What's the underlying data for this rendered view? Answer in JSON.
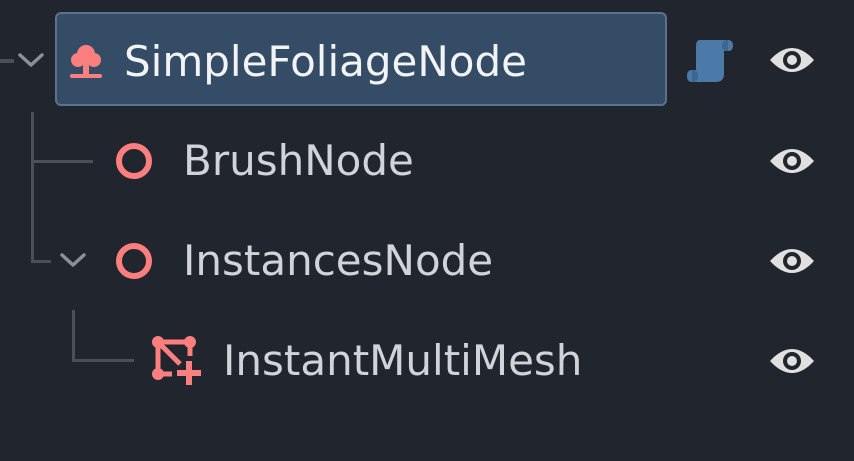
{
  "tree": {
    "nodes": [
      {
        "label": "SimpleFoliageNode",
        "icon": "foliage-tree-icon",
        "selected": true,
        "expanded": true,
        "has_script": true,
        "visible": true
      },
      {
        "label": "BrushNode",
        "icon": "node3d-circle-icon",
        "selected": false,
        "visible": true
      },
      {
        "label": "InstancesNode",
        "icon": "node3d-circle-icon",
        "selected": false,
        "expanded": true,
        "visible": true
      },
      {
        "label": "InstantMultiMesh",
        "icon": "multimesh-icon",
        "selected": false,
        "visible": true
      }
    ]
  },
  "colors": {
    "background": "#21252e",
    "selection": "#354c66",
    "node_icon": "#fc7f7f",
    "script_icon": "#4b7aa8",
    "eye_icon": "#e0e0e0",
    "text": "#d0d3d8"
  }
}
